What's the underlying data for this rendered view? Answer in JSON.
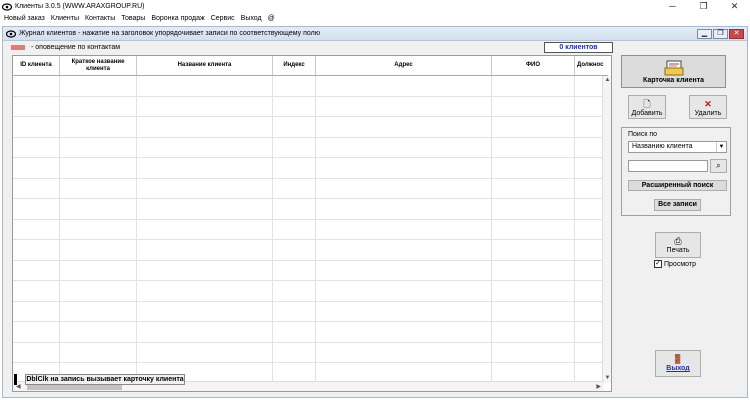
{
  "window": {
    "title": "Клиенты 3.0.5 (WWW.ARAXGROUP.RU)",
    "controls": [
      "─",
      "❐",
      "✕"
    ]
  },
  "menu": [
    "Новый заказ",
    "Клиенты",
    "Контакты",
    "Товары",
    "Воронка продаж",
    "Сервис",
    "Выход",
    "@"
  ],
  "child_window": {
    "title": "Журнал клиентов - нажатие на заголовок упорядочивает записи по соответствующему полю",
    "controls": [
      "▁",
      "❐",
      "✕"
    ]
  },
  "legend": {
    "label": "- оповещение по контактам",
    "color": "#e07a7f"
  },
  "count_label": "0 клиентов",
  "grid": {
    "columns": [
      "ID клиента",
      "Краткое название клиента",
      "Название клиента",
      "Индекс",
      "Адрес",
      "ФИО",
      "Должнос"
    ],
    "scroll_up": "▲",
    "scroll_down": "▼",
    "scroll_left": "◀",
    "scroll_right": "▶"
  },
  "status_text": "DblClk на запись вызывает карточку клиента",
  "panel": {
    "card_button": "Карточка клиента",
    "add_button": "Добавить",
    "delete_button": "Удалить",
    "search_title": "Поиск по",
    "search_by_value": "Названию клиента",
    "search_input_value": "",
    "advanced_search": "Расширенный поиск",
    "all_records": "Все записи",
    "print_button": "Печать",
    "preview_label": "Просмотр",
    "preview_checked": true,
    "exit_button": "Выход"
  }
}
